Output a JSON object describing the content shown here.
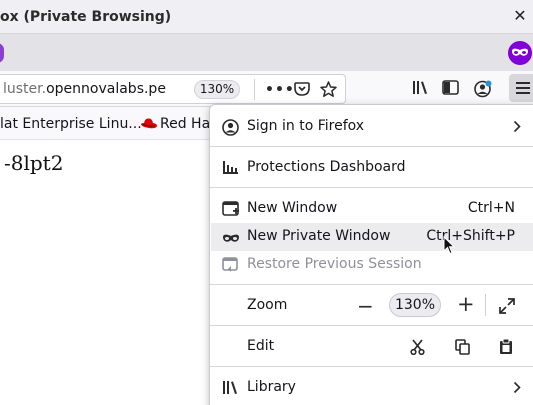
{
  "window": {
    "title": "ox (Private Browsing)",
    "close_glyph": "✕"
  },
  "navbar": {
    "url_prefix": "luster.",
    "url_host": "opennovalabs.pe",
    "zoom": "130%",
    "page_actions_glyph": "•••"
  },
  "bookmarks": {
    "items": [
      {
        "label": "lat Enterprise Linu..."
      },
      {
        "label": "Red Hat"
      }
    ]
  },
  "page": {
    "text": "-8lpt2"
  },
  "menu": {
    "sign_in": "Sign in to Firefox",
    "protections": "Protections Dashboard",
    "new_window": "New Window",
    "new_window_shortcut": "Ctrl+N",
    "new_private_window": "New Private Window",
    "new_private_window_shortcut": "Ctrl+Shift+P",
    "restore_session": "Restore Previous Session",
    "zoom_label": "Zoom",
    "zoom_minus": "−",
    "zoom_level": "130%",
    "zoom_plus": "+",
    "edit_label": "Edit",
    "library": "Library"
  },
  "colors": {
    "private_purple": "#8000d7",
    "menu_highlight": "#ececef"
  }
}
